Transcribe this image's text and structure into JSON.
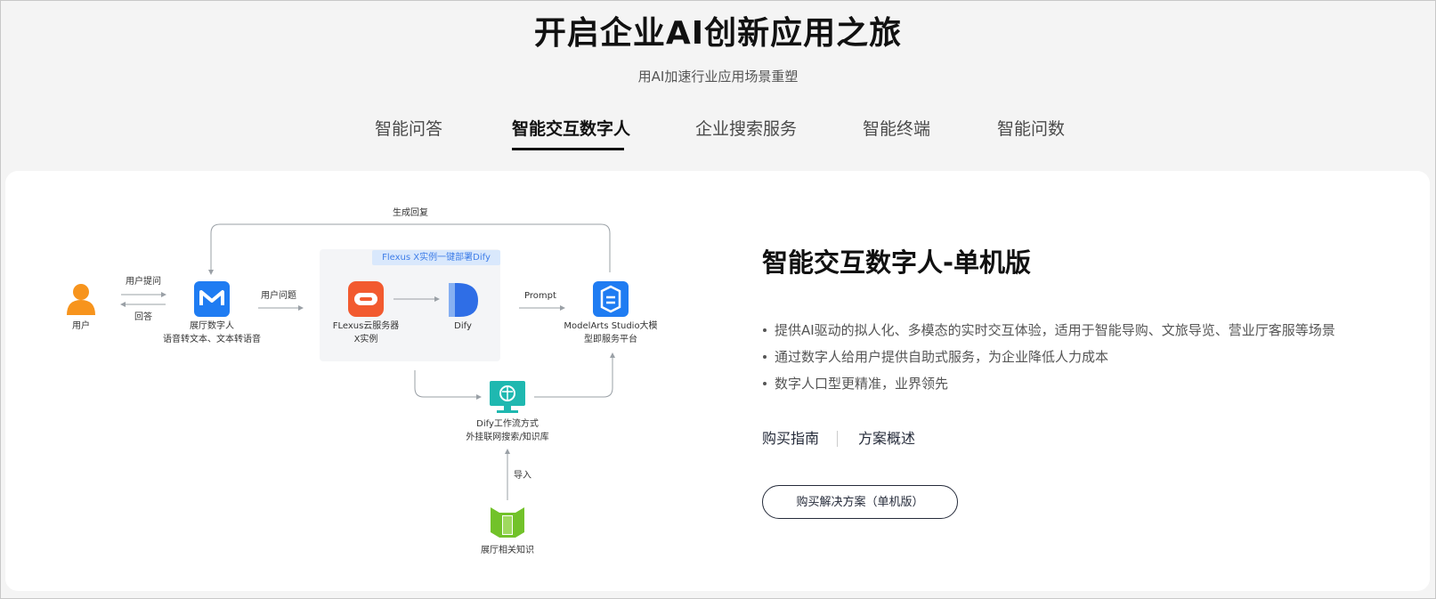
{
  "header": {
    "title": "开启企业AI创新应用之旅",
    "subtitle": "用AI加速行业应用场景重塑"
  },
  "tabs": [
    {
      "label": "智能问答",
      "active": false
    },
    {
      "label": "智能交互数字人",
      "active": true
    },
    {
      "label": "企业搜索服务",
      "active": false
    },
    {
      "label": "智能终端",
      "active": false
    },
    {
      "label": "智能问数",
      "active": false
    }
  ],
  "diagram": {
    "loop_label": "生成回复",
    "user_label": "用户",
    "user_query_label": "用户提问",
    "reply_label": "回答",
    "hall_label_1": "展厅数字人",
    "hall_label_2": "语音转文本、文本转语音",
    "question_label": "用户问题",
    "flexus_tag": "Flexus X实例一键部署Dify",
    "flexus_label_1": "FLexus云服务器",
    "flexus_label_2": "X实例",
    "dify_label": "Dify",
    "prompt_label": "Prompt",
    "modelarts_label_1": "ModelArts Studio大模",
    "modelarts_label_2": "型即服务平台",
    "workflow_label_1": "Dify工作流方式",
    "workflow_label_2": "外挂联网搜索/知识库",
    "import_label": "导入",
    "knowledge_label": "展厅相关知识",
    "colors": {
      "user_icon": "#f7941d",
      "hall_icon": "#1f7cf2",
      "flexus_icon": "#f25a2f",
      "dify_icon": "#2f6ee6",
      "modelarts_icon": "#1f7cf2",
      "workflow_icon": "#1fb8b0",
      "knowledge_icon": "#72c22a",
      "arrow": "#9aa0a6"
    }
  },
  "solution": {
    "title": "智能交互数字人-单机版",
    "bullets": [
      "提供AI驱动的拟人化、多模态的实时交互体验，适用于智能导购、文旅导览、营业厅客服等场景",
      "通过数字人给用户提供自助式服务，为企业降低人力成本",
      "数字人口型更精准，业界领先"
    ],
    "links": [
      "购买指南",
      "方案概述"
    ],
    "buy_button": "购买解决方案（单机版）"
  }
}
